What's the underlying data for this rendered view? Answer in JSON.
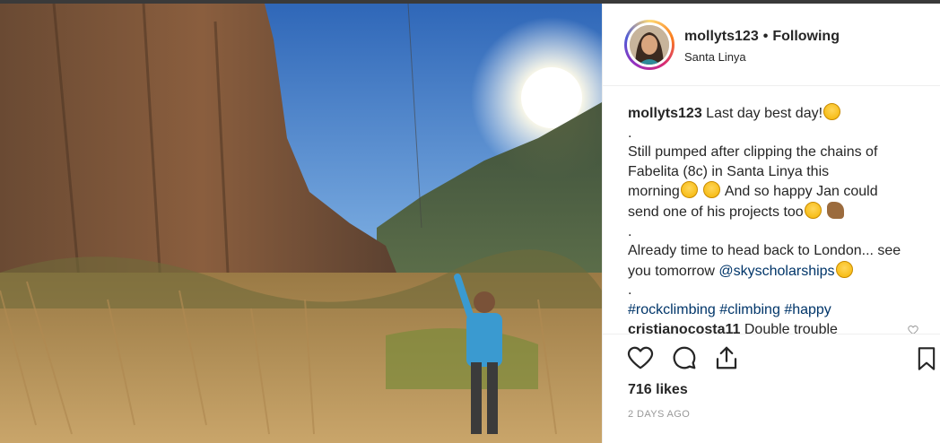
{
  "post": {
    "username": "mollyts123",
    "separator": "•",
    "follow_state": "Following",
    "location": "Santa Linya"
  },
  "caption": {
    "username": "mollyts123",
    "first_line": "Last day best day!",
    "dot1": ".",
    "para1_a": "Still pumped after clipping the chains of",
    "para1_b": "Fabelita (8c) in Santa Linya this",
    "para1_c": "morning",
    "para1_d": "And so happy Jan could",
    "para1_e": "send one of his projects too",
    "dot2": ".",
    "para2_a": "Already time to head back to London... see",
    "para2_b": "you tomorrow",
    "mention": "@skyscholarships",
    "dot3": ".",
    "hashtags": [
      "#rockclimbing",
      "#climbing",
      "#happy"
    ]
  },
  "comment": {
    "username": "cristianocosta11",
    "text": "Double trouble"
  },
  "stats": {
    "likes": "716 likes",
    "time": "2 DAYS AGO"
  },
  "icons": {
    "like": "heart-outline-icon",
    "comment": "speech-bubble-icon",
    "share": "share-upload-icon",
    "save": "bookmark-icon"
  },
  "colors": {
    "link": "#003569",
    "text": "#262626",
    "muted": "#999999",
    "border": "#efefef"
  }
}
